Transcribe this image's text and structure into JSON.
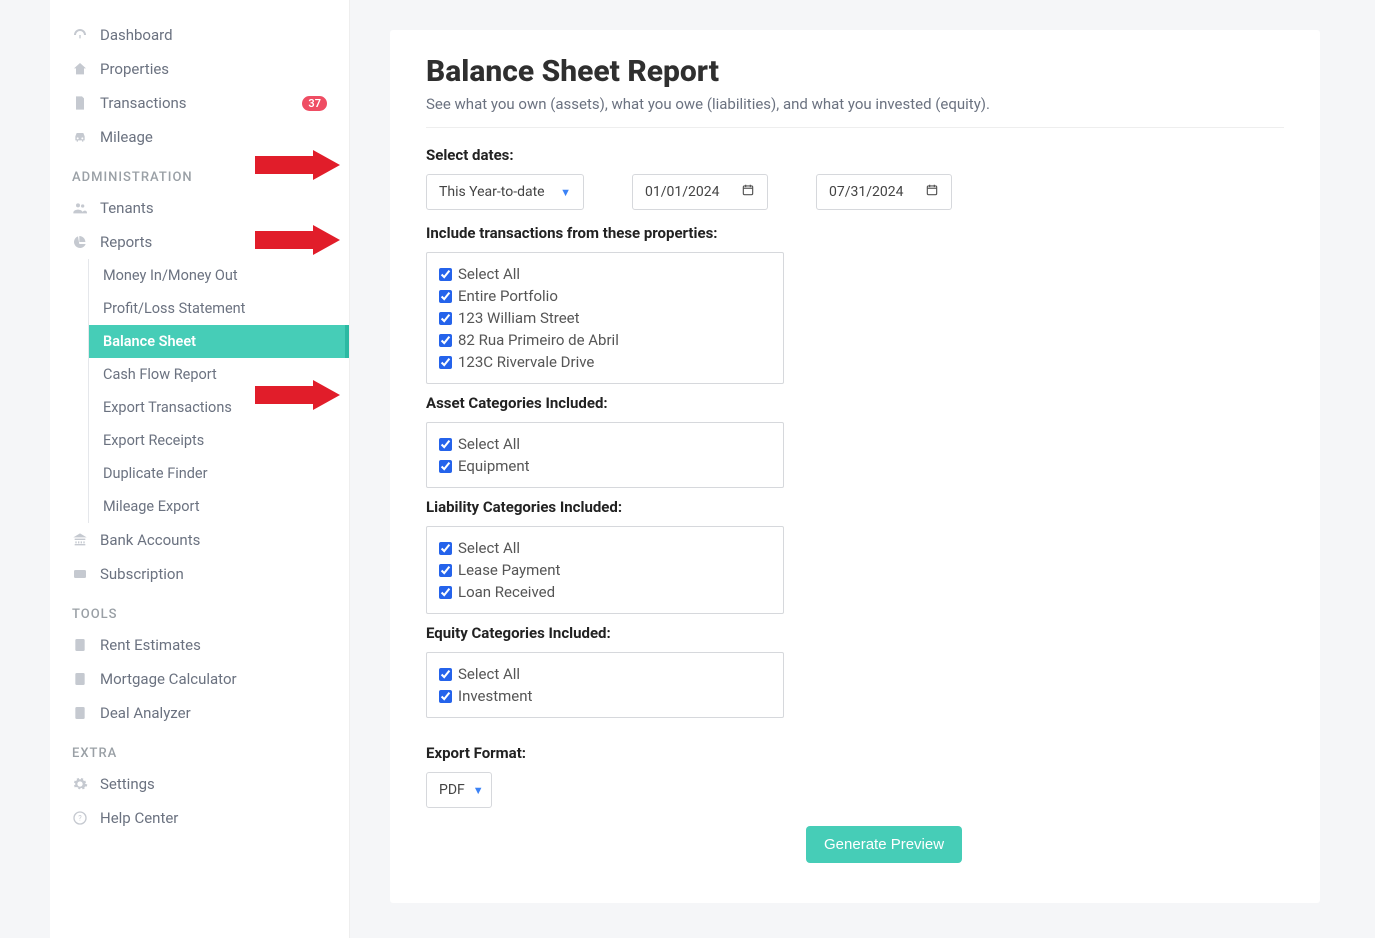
{
  "sidebar": {
    "nav": [
      {
        "label": "Dashboard"
      },
      {
        "label": "Properties"
      },
      {
        "label": "Transactions",
        "badge": "37"
      },
      {
        "label": "Mileage"
      }
    ],
    "sections": {
      "administration": "ADMINISTRATION",
      "tools": "TOOLS",
      "extra": "EXTRA"
    },
    "admin": [
      {
        "label": "Tenants"
      },
      {
        "label": "Reports"
      }
    ],
    "reports_sub": [
      "Money In/Money Out",
      "Profit/Loss Statement",
      "Balance Sheet",
      "Cash Flow Report",
      "Export Transactions",
      "Export Receipts",
      "Duplicate Finder",
      "Mileage Export"
    ],
    "admin2": [
      {
        "label": "Bank Accounts"
      },
      {
        "label": "Subscription"
      }
    ],
    "tools_items": [
      "Rent Estimates",
      "Mortgage Calculator",
      "Deal Analyzer"
    ],
    "extra_items": [
      "Settings",
      "Help Center"
    ]
  },
  "page": {
    "title": "Balance Sheet Report",
    "subtitle": "See what you own (assets), what you owe (liabilities), and what you invested (equity)."
  },
  "dates": {
    "label": "Select dates:",
    "range": "This Year-to-date",
    "start": "01/01/2024",
    "end": "07/31/2024"
  },
  "properties": {
    "label": "Include transactions from these properties:",
    "items": [
      "Select All",
      "Entire Portfolio",
      "123 William Street",
      "82 Rua Primeiro de Abril",
      "123C Rivervale Drive"
    ]
  },
  "assets": {
    "label": "Asset Categories Included:",
    "items": [
      "Select All",
      "Equipment"
    ]
  },
  "liabilities": {
    "label": "Liability Categories Included:",
    "items": [
      "Select All",
      "Lease Payment",
      "Loan Received"
    ]
  },
  "equity": {
    "label": "Equity Categories Included:",
    "items": [
      "Select All",
      "Investment"
    ]
  },
  "export": {
    "label": "Export Format:",
    "value": "PDF"
  },
  "button": {
    "generate": "Generate Preview"
  }
}
